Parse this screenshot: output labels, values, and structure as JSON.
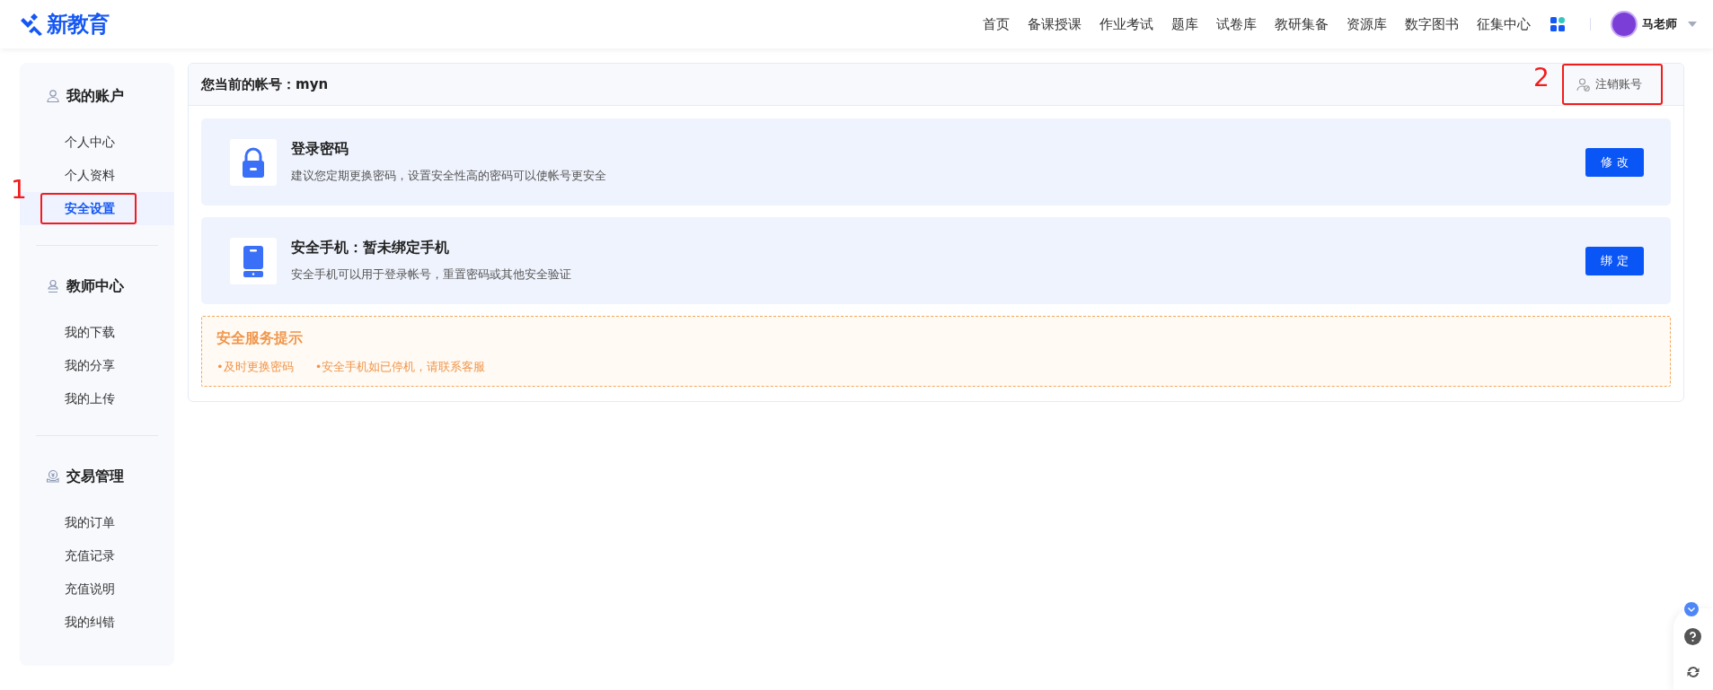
{
  "header": {
    "logo": "新教育",
    "nav": [
      {
        "label": "首页"
      },
      {
        "label": "备课授课"
      },
      {
        "label": "作业考试"
      },
      {
        "label": "题库"
      },
      {
        "label": "试卷库"
      },
      {
        "label": "教研集备"
      },
      {
        "label": "资源库"
      },
      {
        "label": "数字图书"
      },
      {
        "label": "征集中心"
      }
    ],
    "user": "马老师"
  },
  "sidebar": {
    "sections": [
      {
        "kind": "account",
        "title": "我的账户",
        "items": [
          {
            "label": "个人中心",
            "selected": false
          },
          {
            "label": "个人资料",
            "selected": false
          },
          {
            "label": "安全设置",
            "selected": true,
            "annotation": "1"
          }
        ]
      },
      {
        "kind": "teacher",
        "title": "教师中心",
        "items": [
          {
            "label": "我的下载",
            "selected": false
          },
          {
            "label": "我的分享",
            "selected": false
          },
          {
            "label": "我的上传",
            "selected": false
          }
        ]
      },
      {
        "kind": "trade",
        "title": "交易管理",
        "items": [
          {
            "label": "我的订单",
            "selected": false
          },
          {
            "label": "充值记录",
            "selected": false
          },
          {
            "label": "充值说明",
            "selected": false
          },
          {
            "label": "我的纠错",
            "selected": false
          }
        ]
      }
    ]
  },
  "main": {
    "account_label": "您当前的帐号：myn",
    "cancel_account": {
      "label": "注销账号",
      "annotation": "2"
    },
    "cards": [
      {
        "kind": "password",
        "title": "登录密码",
        "description": "建议您定期更换密码，设置安全性高的密码可以使帐号更安全",
        "button": "修 改"
      },
      {
        "kind": "phone",
        "title": "安全手机：暂未绑定手机",
        "description": "安全手机可以用于登录帐号，重置密码或其他安全验证",
        "button": "绑 定"
      }
    ],
    "tips": {
      "title": "安全服务提示",
      "items": [
        "•及时更换密码",
        "•安全手机如已停机，请联系客服"
      ]
    }
  }
}
